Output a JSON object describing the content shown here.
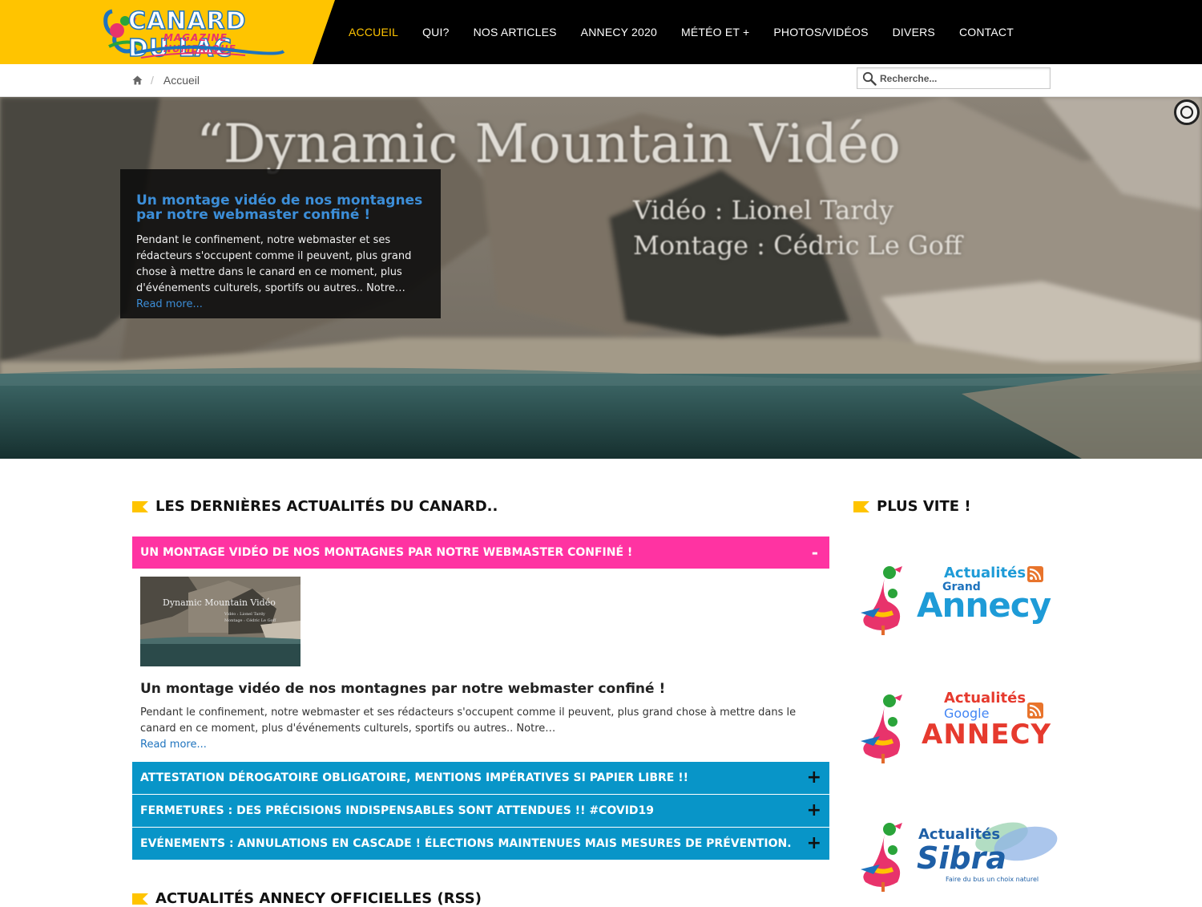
{
  "logo": {
    "title": "CANARD DU LAC",
    "subtitle": "MAGAZINE NUMERIQUE"
  },
  "nav": {
    "items": [
      "ACCUEIL",
      "QUI?",
      "NOS ARTICLES",
      "ANNECY 2020",
      "MÉTÉO ET +",
      "PHOTOS/VIDÉOS",
      "DIVERS",
      "CONTACT"
    ],
    "active_index": 0,
    "active_color": "#ffc400"
  },
  "breadcrumb": {
    "current": "Accueil",
    "separator": "/"
  },
  "search": {
    "placeholder": "Recherche..."
  },
  "hero": {
    "video_title": "“Dynamic Mountain Vidéo",
    "credit_video": "Vidéo : Lionel Tardy",
    "credit_montage": "Montage : Cédric Le Goff",
    "caption_title": "Un montage vidéo de nos montagnes par notre webmaster confiné !",
    "caption_text": "Pendant le confinement, notre webmaster et ses rédacteurs s'occupent comme il peuvent, plus grand chose à mettre dans le canard en ce moment, plus d'événements culturels, sportifs ou autres.. Notre…",
    "caption_more": "Read more..."
  },
  "news": {
    "heading": "LES DERNIÈRES ACTUALITÉS DU CANARD..",
    "open_item": {
      "label": "UN MONTAGE VIDÉO DE NOS MONTAGNES PAR NOTRE WEBMASTER CONFINÉ !",
      "toggle": "-",
      "thumb_title": "Dynamic Mountain Vidéo",
      "thumb_credit1": "Vidéo : Lionel Tardy",
      "thumb_credit2": "Montage : Cédric Le Goff",
      "title": "Un montage vidéo de nos montagnes par notre webmaster confiné !",
      "text": "Pendant le confinement, notre webmaster et ses rédacteurs s'occupent comme il peuvent, plus grand chose à mettre dans le canard en ce moment, plus d'événements culturels, sportifs ou autres.. Notre…",
      "more": "Read more..."
    },
    "items": [
      {
        "label": "ATTESTATION DÉROGATOIRE OBLIGATOIRE, MENTIONS IMPÉRATIVES SI PAPIER LIBRE !!",
        "toggle": "+"
      },
      {
        "label": "FERMETURES : DES PRÉCISIONS INDISPENSABLES SONT ATTENDUES !! #COVID19",
        "toggle": "+"
      },
      {
        "label": "EVÉNEMENTS : ANNULATIONS EN CASCADE ! ÉLECTIONS MAINTENUES MAIS MESURES DE PRÉVENTION.",
        "toggle": "+"
      }
    ],
    "open_color": "#ff33a2",
    "closed_color": "#0895c8"
  },
  "official": {
    "heading": "ACTUALITÉS ANNECY OFFICIELLES (RSS)"
  },
  "sidebar": {
    "heading": "PLUS VITE !",
    "cards": [
      {
        "line1": "Actualités",
        "line2": "Grand",
        "line3": "Annecy"
      },
      {
        "line1": "Actualités",
        "line2": "Google",
        "line3": "ANNECY"
      },
      {
        "line1": "Actualités",
        "line2": "Sibra",
        "line3": "Faire du bus un choix naturel"
      }
    ]
  },
  "colors": {
    "brand_yellow": "#ffc400",
    "header_bg": "#000000",
    "link_blue": "#1e73be"
  }
}
